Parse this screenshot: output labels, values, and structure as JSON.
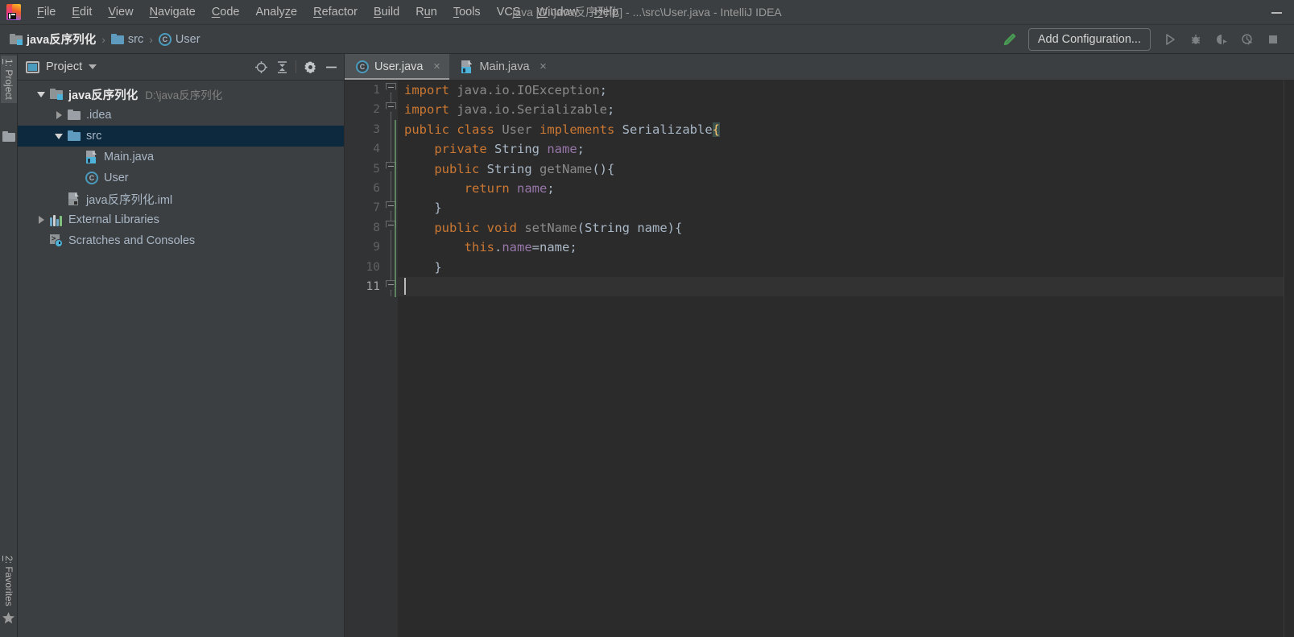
{
  "window": {
    "title": "java [D:\\java反序列化] - ...\\src\\User.java - IntelliJ IDEA",
    "logo_name": "intellij-idea-logo",
    "minimize_label": "—"
  },
  "menubar": {
    "items": [
      {
        "label": "File",
        "mnemonic": "F"
      },
      {
        "label": "Edit",
        "mnemonic": "E"
      },
      {
        "label": "View",
        "mnemonic": "V"
      },
      {
        "label": "Navigate",
        "mnemonic": "N"
      },
      {
        "label": "Code",
        "mnemonic": "C"
      },
      {
        "label": "Analyze",
        "mnemonic": "z"
      },
      {
        "label": "Refactor",
        "mnemonic": "R"
      },
      {
        "label": "Build",
        "mnemonic": "B"
      },
      {
        "label": "Run",
        "mnemonic": "u"
      },
      {
        "label": "Tools",
        "mnemonic": "T"
      },
      {
        "label": "VCS",
        "mnemonic": "S"
      },
      {
        "label": "Window",
        "mnemonic": "W"
      },
      {
        "label": "Help",
        "mnemonic": "H"
      }
    ]
  },
  "navbar": {
    "breadcrumbs": [
      {
        "label": "java反序列化",
        "icon": "module-folder-icon"
      },
      {
        "label": "src",
        "icon": "source-folder-icon"
      },
      {
        "label": "User",
        "icon": "class-icon"
      }
    ],
    "separator": "›",
    "build_icon": "build-hammer-icon",
    "add_configuration_label": "Add Configuration...",
    "run_icons": [
      "run-icon",
      "debug-icon",
      "run-with-coverage-icon",
      "profile-icon",
      "stop-icon"
    ]
  },
  "toolstrip": {
    "top_tab": {
      "label": "1: Project",
      "mnemonic": "1",
      "selected": true,
      "icon": "project-folder-icon"
    },
    "bottom_tab": {
      "label": "2: Favorites",
      "mnemonic": "2",
      "selected": false,
      "icon": "favorites-star-icon"
    }
  },
  "project_panel": {
    "title": "Project",
    "window_icon": "project-window-icon",
    "caret_icon": "chevron-down-icon",
    "tool_icons": [
      "locate-target-icon",
      "collapse-all-icon",
      "settings-gear-icon",
      "hide-minimize-icon"
    ],
    "tree": [
      {
        "label": "java反序列化",
        "path": "D:\\java反序列化",
        "icon": "module-folder-icon",
        "indent": 0,
        "twisty": "expanded",
        "bold": true,
        "selected": false
      },
      {
        "label": ".idea",
        "path": "",
        "icon": "gray-folder-icon",
        "indent": 1,
        "twisty": "collapsed",
        "bold": false,
        "selected": false
      },
      {
        "label": "src",
        "path": "",
        "icon": "source-folder-icon",
        "indent": 1,
        "twisty": "expanded",
        "bold": false,
        "selected": true
      },
      {
        "label": "Main.java",
        "path": "",
        "icon": "java-file-icon",
        "indent": 2,
        "twisty": "none",
        "bold": false,
        "selected": false
      },
      {
        "label": "User",
        "path": "",
        "icon": "class-icon",
        "indent": 2,
        "twisty": "none",
        "bold": false,
        "selected": false
      },
      {
        "label": "java反序列化.iml",
        "path": "",
        "icon": "iml-file-icon",
        "indent": 1,
        "twisty": "none",
        "bold": false,
        "selected": false
      },
      {
        "label": "External Libraries",
        "path": "",
        "icon": "library-icon",
        "indent": 0,
        "twisty": "collapsed",
        "bold": false,
        "selected": false
      },
      {
        "label": "Scratches and Consoles",
        "path": "",
        "icon": "scratches-icon",
        "indent": 0,
        "twisty": "none",
        "bold": false,
        "selected": false
      }
    ]
  },
  "editor": {
    "tabs": [
      {
        "label": "User.java",
        "icon": "class-icon",
        "active": true,
        "close": "×"
      },
      {
        "label": "Main.java",
        "icon": "java-file-icon",
        "active": false,
        "close": "×"
      }
    ],
    "line_numbers": [
      "1",
      "2",
      "3",
      "4",
      "5",
      "6",
      "7",
      "8",
      "9",
      "10",
      "11"
    ],
    "caret_line": 11,
    "lines": [
      {
        "n": "1",
        "text": "import java.io.IOException;"
      },
      {
        "n": "2",
        "text": "import java.io.Serializable;"
      },
      {
        "n": "3",
        "text": "public class User implements Serializable{"
      },
      {
        "n": "4",
        "text": "    private String name;"
      },
      {
        "n": "5",
        "text": "    public String getName(){"
      },
      {
        "n": "6",
        "text": "        return name;"
      },
      {
        "n": "7",
        "text": "    }"
      },
      {
        "n": "8",
        "text": "    public void setName(String name){"
      },
      {
        "n": "9",
        "text": "        this.name=name;"
      },
      {
        "n": "10",
        "text": "    }"
      },
      {
        "n": "11",
        "text": "}"
      }
    ],
    "colors": {
      "background": "#2b2b2b",
      "gutter": "#313335",
      "keyword": "#cc7832",
      "field": "#9876aa",
      "method": "#8a8a8a",
      "text": "#a9b7c6",
      "caret_row": "#323232",
      "brace_match_bg": "#3b514d",
      "brace_match_fg": "#ffc66d",
      "vcs_stripe": "#6d9e6d",
      "selection": "#0d293e",
      "accent": "#4a9bbd"
    }
  }
}
